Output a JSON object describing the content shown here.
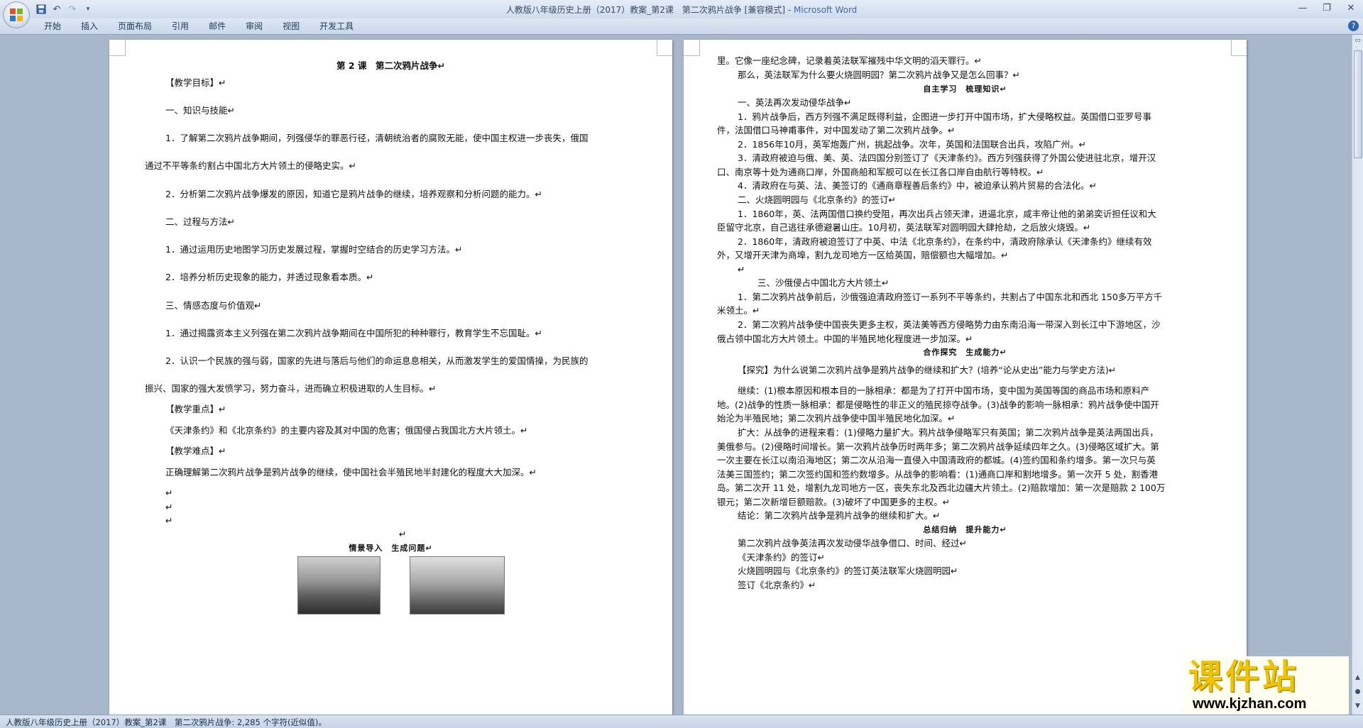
{
  "window": {
    "title_doc": "人教版八年级历史上册（2017）教案_第2课　第二次鸦片战争 [兼容模式] - ",
    "title_app": "Microsoft Word"
  },
  "ribbon": {
    "tabs": [
      "开始",
      "插入",
      "页面布局",
      "引用",
      "邮件",
      "审阅",
      "视图",
      "开发工具"
    ]
  },
  "left_page": {
    "title": "第 2 课　第二次鸦片战争↵",
    "lines": [
      "【教学目标】↵",
      "一、知识与技能↵",
      "1．了解第二次鸦片战争期间，列强侵华的罪恶行径，清朝统治者的腐败无能，使中国主权进一步丧失，俄国",
      "通过不平等条约割占中国北方大片领土的侵略史实。↵",
      "2．分析第二次鸦片战争爆发的原因，知道它是鸦片战争的继续，培养观察和分析问题的能力。↵",
      "二、过程与方法↵",
      "1．通过运用历史地图学习历史发展过程，掌握时空结合的历史学习方法。↵",
      "2．培养分析历史现象的能力，并透过现象看本质。↵",
      "三、情感态度与价值观↵",
      "1．通过揭露资本主义列强在第二次鸦片战争期间在中国所犯的种种罪行，教育学生不忘国耻。↵",
      "2．认识一个民族的强与弱，国家的先进与落后与他们的命运息息相关，从而激发学生的爱国情操，为民族的",
      "振兴、国家的强大发愤学习，努力奋斗，进而确立积极进取的人生目标。↵",
      "【教学重点】↵",
      "《天津条约》和《北京条约》的主要内容及其对中国的危害；俄国侵占我国北方大片领土。↵",
      "【教学难点】↵",
      "正确理解第二次鸦片战争是鸦片战争的继续，使中国社会半殖民地半封建化的程度大大加深。↵",
      "↵",
      "↵",
      "↵",
      "↵"
    ],
    "section_heading": "情景导入　生成问题↵"
  },
  "right_page": {
    "lines": [
      "里。它像一座纪念碑，记录着英法联军摧残中华文明的滔天罪行。↵",
      "那么，英法联军为什么要火烧圆明园？第二次鸦片战争又是怎么回事？↵",
      "自主学习　梳理知识↵",
      "一、英法再次发动侵华战争↵",
      "1．鸦片战争后，西方列强不满足既得利益，企图进一步打开中国市场，扩大侵略权益。英国借口亚罗号事",
      "件，法国借口马神甫事件，对中国发动了第二次鸦片战争。↵",
      "2．1856年10月，英军炮轰广州，挑起战争。次年，英国和法国联合出兵，攻陷广州。↵",
      "3．清政府被迫与俄、美、英、法四国分别签订了《天津条约》。西方列强获得了外国公使进驻北京，增开汉",
      "口、南京等十处为通商口岸，外国商船和军舰可以在长江各口岸自由航行等特权。↵",
      "4．清政府在与英、法、美签订的《通商章程善后条约》中，被迫承认鸦片贸易的合法化。↵",
      "二、火烧圆明园与《北京条约》的签订↵",
      "1．1860年，英、法两国借口换约受阻，再次出兵占领天津，进逼北京，咸丰帝让他的弟弟奕䜣担任议和大",
      "臣留守北京，自己逃往承德避暑山庄。10月初，英法联军对圆明园大肆抢劫，之后放火烧毁。↵",
      "2．1860年，清政府被迫签订了中英、中法《北京条约》，在条约中，清政府除承认《天津条约》继续有效",
      "外，又增开天津为商埠，割九龙司地方一区给英国，赔偿额也大幅增加。↵",
      "↵",
      "三、沙俄侵占中国北方大片领土↵",
      "1．第二次鸦片战争前后，沙俄强迫清政府签订一系列不平等条约，共割占了中国东北和西北 150多万平方千",
      "米领土。↵",
      "2．第二次鸦片战争使中国丧失更多主权，英法美等西方侵略势力由东南沿海一带深入到长江中下游地区，沙",
      "俄占领中国北方大片领土。中国的半殖民地化程度进一步加深。↵",
      "合作探究　生成能力↵",
      "【探究】为什么说第二次鸦片战争是鸦片战争的继续和扩大？(培养“论从史出”能力与学史方法)↵",
      "继续：(1)根本原因和根本目的一脉相承：都是为了打开中国市场，变中国为英国等国的商品市场和原料产",
      "地。(2)战争的性质一脉相承：都是侵略性的非正义的殖民掠夺战争。(3)战争的影响一脉相承：鸦片战争使中国开",
      "始沦为半殖民地；第二次鸦片战争使中国半殖民地化加深。↵",
      "扩大：从战争的进程来看：(1)侵略力量扩大。鸦片战争侵略军只有英国；第二次鸦片战争是英法两国出兵，",
      "美俄参与。(2)侵略时间增长。第一次鸦片战争历时两年多；第二次鸦片战争延续四年之久。(3)侵略区域扩大。第",
      "一次主要在长江以南沿海地区；第二次从沿海一直侵入中国清政府的都城。(4)签约国和条约增多。第一次只与英",
      "法美三国签约；第二次签约国和签约数增多。从战争的影响看：(1)通商口岸和割地增多。第一次开 5 处，割香港",
      "岛。第二次开 11 处，增割九龙司地方一区，丧失东北及西北边疆大片领土。(2)赔款增加：第一次是赔款 2 100万",
      "银元；第二次新增巨额赔款。(3)破坏了中国更多的主权。↵",
      "结论：第二次鸦片战争是鸦片战争的继续和扩大。↵",
      "总结归纳　提升能力↵",
      "第二次鸦片战争英法再次发动侵华战争借口、时间、经过↵",
      "《天津条约》的签订↵",
      "火烧圆明园与《北京条约》的签订英法联军火烧圆明园↵",
      "签订《北京条约》↵"
    ]
  },
  "status_bar": {
    "text": "人教版八年级历史上册（2017）教案_第2课　第二次鸦片战争: 2,285 个字符(近似值)。"
  },
  "watermark": {
    "main": "课件站",
    "url": "www.kjzhan.com"
  },
  "colors": {
    "title_bar": "#cfdcee",
    "workspace": "#a9b7ca",
    "app_name": "#3d67b5",
    "watermark": "#f0c200"
  },
  "icons": [
    "office-logo-icon",
    "save-icon",
    "undo-icon",
    "redo-icon",
    "customize-icon",
    "minimize-icon",
    "maximize-icon",
    "close-icon",
    "help-icon"
  ]
}
